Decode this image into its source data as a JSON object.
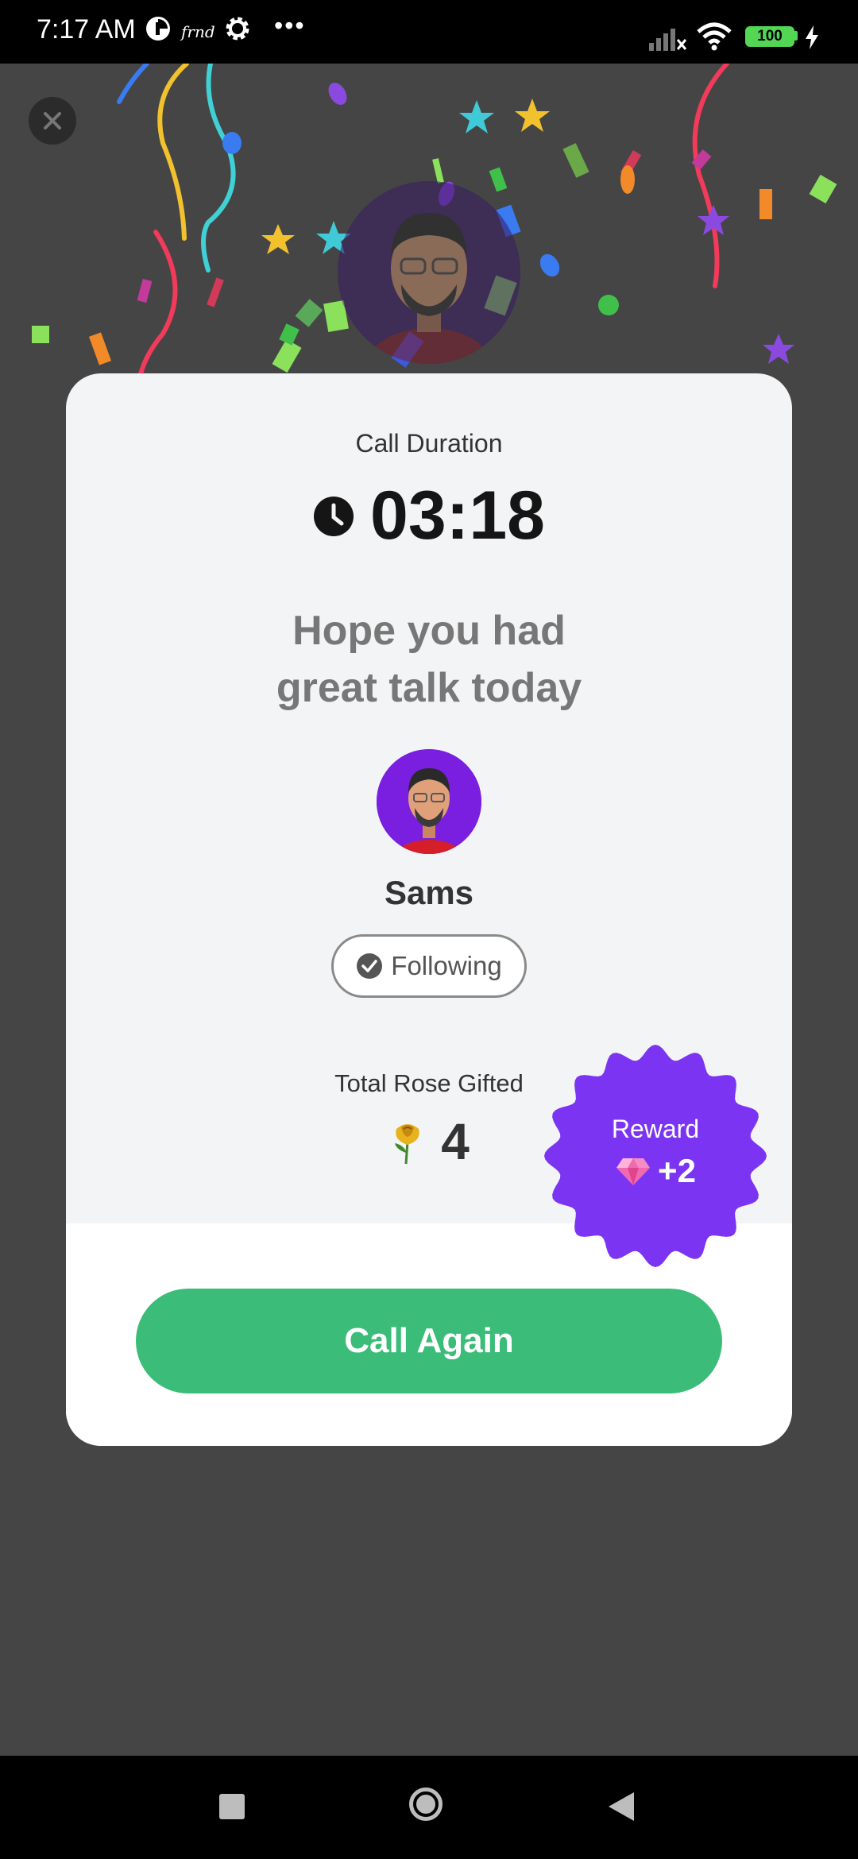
{
  "status_bar": {
    "time": "7:17 AM",
    "app_label": "frnd",
    "battery": "100",
    "overflow": "•••"
  },
  "icons": {
    "close": "close-icon",
    "clock": "clock-icon",
    "check": "check-circle-icon",
    "rose": "rose-icon",
    "gem": "gem-icon",
    "nav": [
      "recent-apps-icon",
      "home-icon",
      "back-icon"
    ]
  },
  "summary": {
    "duration_label": "Call Duration",
    "duration_value": "03:18",
    "message": "Hope you had\ngreat talk today",
    "user_name": "Sams",
    "follow_label": "Following",
    "rose_label": "Total Rose Gifted",
    "rose_count": "4"
  },
  "reward": {
    "label": "Reward",
    "value": "+2"
  },
  "actions": {
    "call_again": "Call Again"
  },
  "colors": {
    "accent_green": "#3bbc78",
    "reward_purple": "#7b35f2",
    "background": "#454545"
  }
}
